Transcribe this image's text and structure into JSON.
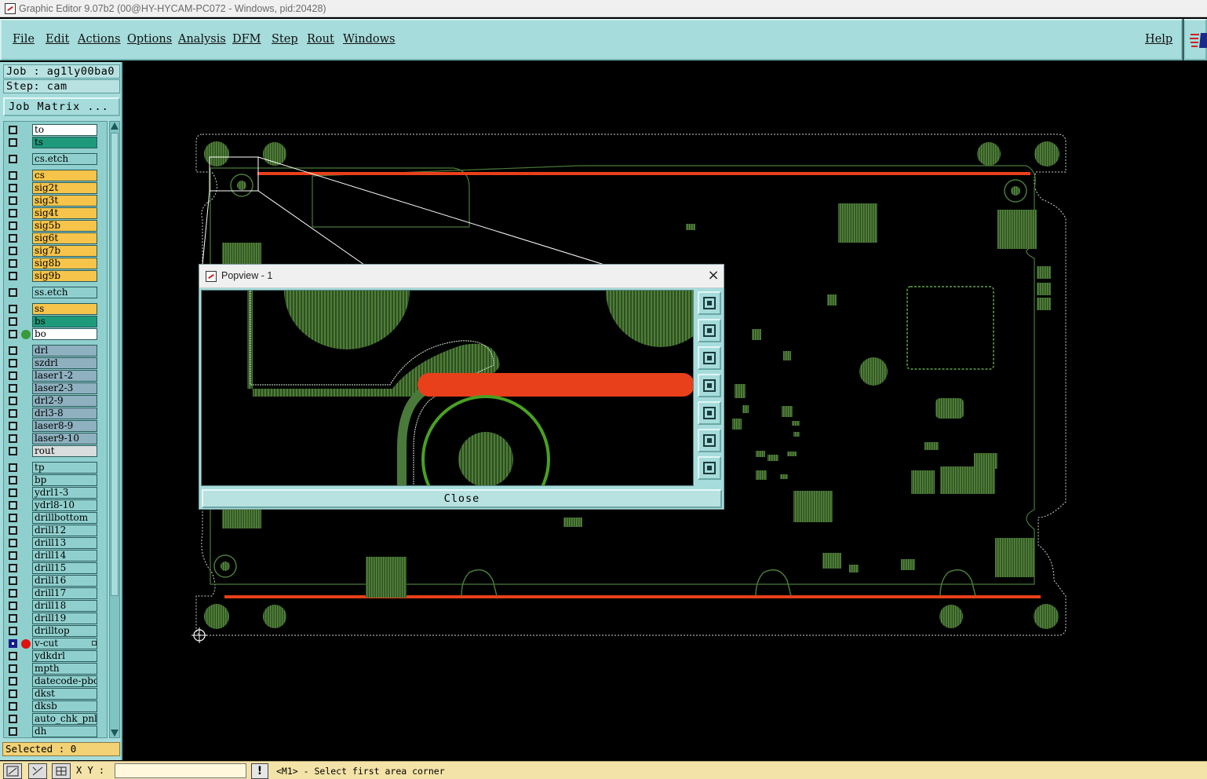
{
  "window": {
    "title": "Graphic Editor 9.07b2 (00@HY-HYCAM-PC072 - Windows, pid:20428)"
  },
  "menu": {
    "items": [
      "File",
      "Edit",
      "Actions",
      "Options",
      "Analysis",
      "DFM",
      "Step",
      "Rout",
      "Windows"
    ],
    "help": "Help"
  },
  "job": {
    "job_label": "Job : ag1ly00ba0",
    "step_label": "Step: cam",
    "matrix_button": "Job Matrix ..."
  },
  "layers": [
    {
      "name": "to",
      "color": "#ffffff"
    },
    {
      "name": "ts",
      "color": "#1e9a7a"
    },
    {
      "name": "cs.etch",
      "color": "#8fd0ce",
      "gap_before": true
    },
    {
      "name": "cs",
      "color": "#f6c44a",
      "gap_before": true
    },
    {
      "name": "sig2t",
      "color": "#f6c44a"
    },
    {
      "name": "sig3t",
      "color": "#f6c44a"
    },
    {
      "name": "sig4t",
      "color": "#f6c44a"
    },
    {
      "name": "sig5b",
      "color": "#f6c44a"
    },
    {
      "name": "sig6t",
      "color": "#f6c44a"
    },
    {
      "name": "sig7b",
      "color": "#f6c44a"
    },
    {
      "name": "sig8b",
      "color": "#f6c44a"
    },
    {
      "name": "sig9b",
      "color": "#f6c44a"
    },
    {
      "name": "ss.etch",
      "color": "#8fd0ce",
      "gap_before": true
    },
    {
      "name": "ss",
      "color": "#f6c44a",
      "gap_before": true
    },
    {
      "name": "bs",
      "color": "#1e9a7a"
    },
    {
      "name": "bo",
      "color": "#ffffff",
      "dot": "#3a9a3a"
    },
    {
      "name": "drl",
      "color": "#8eb0bf",
      "gap_before": true
    },
    {
      "name": "szdrl",
      "color": "#8eb0bf"
    },
    {
      "name": "laser1-2",
      "color": "#8eb0bf"
    },
    {
      "name": "laser2-3",
      "color": "#8eb0bf"
    },
    {
      "name": "drl2-9",
      "color": "#8eb0bf"
    },
    {
      "name": "drl3-8",
      "color": "#8eb0bf"
    },
    {
      "name": "laser8-9",
      "color": "#8eb0bf"
    },
    {
      "name": "laser9-10",
      "color": "#8eb0bf"
    },
    {
      "name": "rout",
      "color": "#d9dddd"
    },
    {
      "name": "tp",
      "color": "#8fd0ce",
      "gap_before": true
    },
    {
      "name": "bp",
      "color": "#8fd0ce"
    },
    {
      "name": "ydrl1-3",
      "color": "#8fd0ce"
    },
    {
      "name": "ydrl8-10",
      "color": "#8fd0ce"
    },
    {
      "name": "drillbottom",
      "color": "#8fd0ce"
    },
    {
      "name": "drill12",
      "color": "#8fd0ce"
    },
    {
      "name": "drill13",
      "color": "#8fd0ce"
    },
    {
      "name": "drill14",
      "color": "#8fd0ce"
    },
    {
      "name": "drill15",
      "color": "#8fd0ce"
    },
    {
      "name": "drill16",
      "color": "#8fd0ce"
    },
    {
      "name": "drill17",
      "color": "#8fd0ce"
    },
    {
      "name": "drill18",
      "color": "#8fd0ce"
    },
    {
      "name": "drill19",
      "color": "#8fd0ce"
    },
    {
      "name": "drilltop",
      "color": "#8fd0ce"
    },
    {
      "name": "v-cut",
      "color": "#8fd0ce",
      "dot": "#e01010",
      "checked": true
    },
    {
      "name": "ydkdrl",
      "color": "#8fd0ce"
    },
    {
      "name": "mpth",
      "color": "#8fd0ce"
    },
    {
      "name": "datecode-pbc",
      "color": "#8fd0ce"
    },
    {
      "name": "dkst",
      "color": "#8fd0ce"
    },
    {
      "name": "dksb",
      "color": "#8fd0ce"
    },
    {
      "name": "auto_chk_pnl",
      "color": "#8fd0ce"
    },
    {
      "name": "dh",
      "color": "#8fd0ce"
    }
  ],
  "selected_label": "Selected : 0",
  "popview": {
    "title": "Popview - 1",
    "close_label": "Close",
    "tools": [
      "zoom-window-icon",
      "pan-up-icon",
      "pan-down-icon",
      "pan-left-icon",
      "pan-right-icon",
      "zoom-home-icon",
      "zoom-fit-icon"
    ]
  },
  "status": {
    "xy_label": "X Y :",
    "xy_value": "",
    "warn": "!",
    "message": "<M1> - Select first area corner"
  },
  "colors": {
    "panel": "#a6dcdb",
    "board_green": "#3f6a2e",
    "vcut_red": "#e8401a",
    "selected_bg": "#f3d275"
  }
}
